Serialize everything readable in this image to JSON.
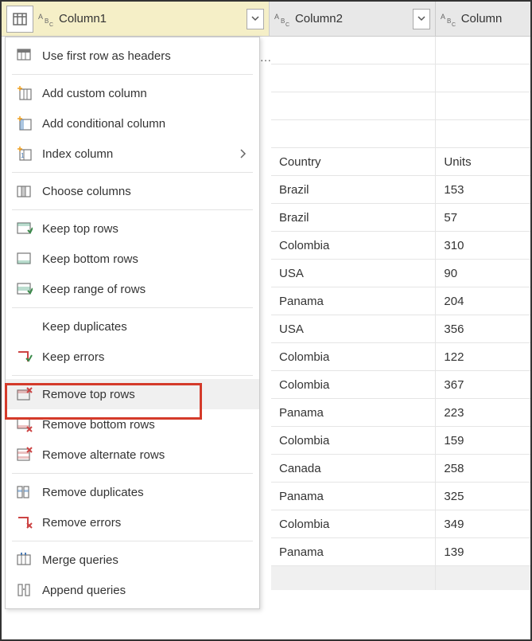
{
  "columns": {
    "col1": "Column1",
    "col2": "Column2",
    "col3": "Column"
  },
  "menu": {
    "group1": [
      {
        "label": "Use first row as headers",
        "icon": "headers"
      }
    ],
    "group2": [
      {
        "label": "Add custom column",
        "icon": "add-col"
      },
      {
        "label": "Add conditional column",
        "icon": "cond-col"
      },
      {
        "label": "Index column",
        "icon": "index-col",
        "has_arrow": true
      }
    ],
    "group3": [
      {
        "label": "Choose columns",
        "icon": "choose-col"
      }
    ],
    "group4": [
      {
        "label": "Keep top rows",
        "icon": "keep-top"
      },
      {
        "label": "Keep bottom rows",
        "icon": "keep-bottom"
      },
      {
        "label": "Keep range of rows",
        "icon": "keep-range"
      }
    ],
    "group5": [
      {
        "label": "Keep duplicates",
        "icon": "blank"
      },
      {
        "label": "Keep errors",
        "icon": "keep-errors"
      }
    ],
    "group6": [
      {
        "label": "Remove top rows",
        "icon": "remove-top"
      },
      {
        "label": "Remove bottom rows",
        "icon": "remove-bottom"
      },
      {
        "label": "Remove alternate rows",
        "icon": "remove-alt"
      }
    ],
    "group7": [
      {
        "label": "Remove duplicates",
        "icon": "remove-dup"
      },
      {
        "label": "Remove errors",
        "icon": "remove-err"
      }
    ],
    "group8": [
      {
        "label": "Merge queries",
        "icon": "merge"
      },
      {
        "label": "Append queries",
        "icon": "append"
      }
    ]
  },
  "rows": [
    {
      "c2": "",
      "c3": ""
    },
    {
      "c2": "",
      "c3": ""
    },
    {
      "c2": "",
      "c3": ""
    },
    {
      "c2": "",
      "c3": ""
    },
    {
      "c2": "Country",
      "c3": "Units"
    },
    {
      "c2": "Brazil",
      "c3": "153"
    },
    {
      "c2": "Brazil",
      "c3": "57"
    },
    {
      "c2": "Colombia",
      "c3": "310"
    },
    {
      "c2": "USA",
      "c3": "90"
    },
    {
      "c2": "Panama",
      "c3": "204"
    },
    {
      "c2": "USA",
      "c3": "356"
    },
    {
      "c2": "Colombia",
      "c3": "122"
    },
    {
      "c2": "Colombia",
      "c3": "367"
    },
    {
      "c2": "Panama",
      "c3": "223"
    },
    {
      "c2": "Colombia",
      "c3": "159"
    },
    {
      "c2": "Canada",
      "c3": "258"
    },
    {
      "c2": "Panama",
      "c3": "325"
    },
    {
      "c2": "Colombia",
      "c3": "349"
    },
    {
      "c2": "Panama",
      "c3": "139"
    }
  ]
}
